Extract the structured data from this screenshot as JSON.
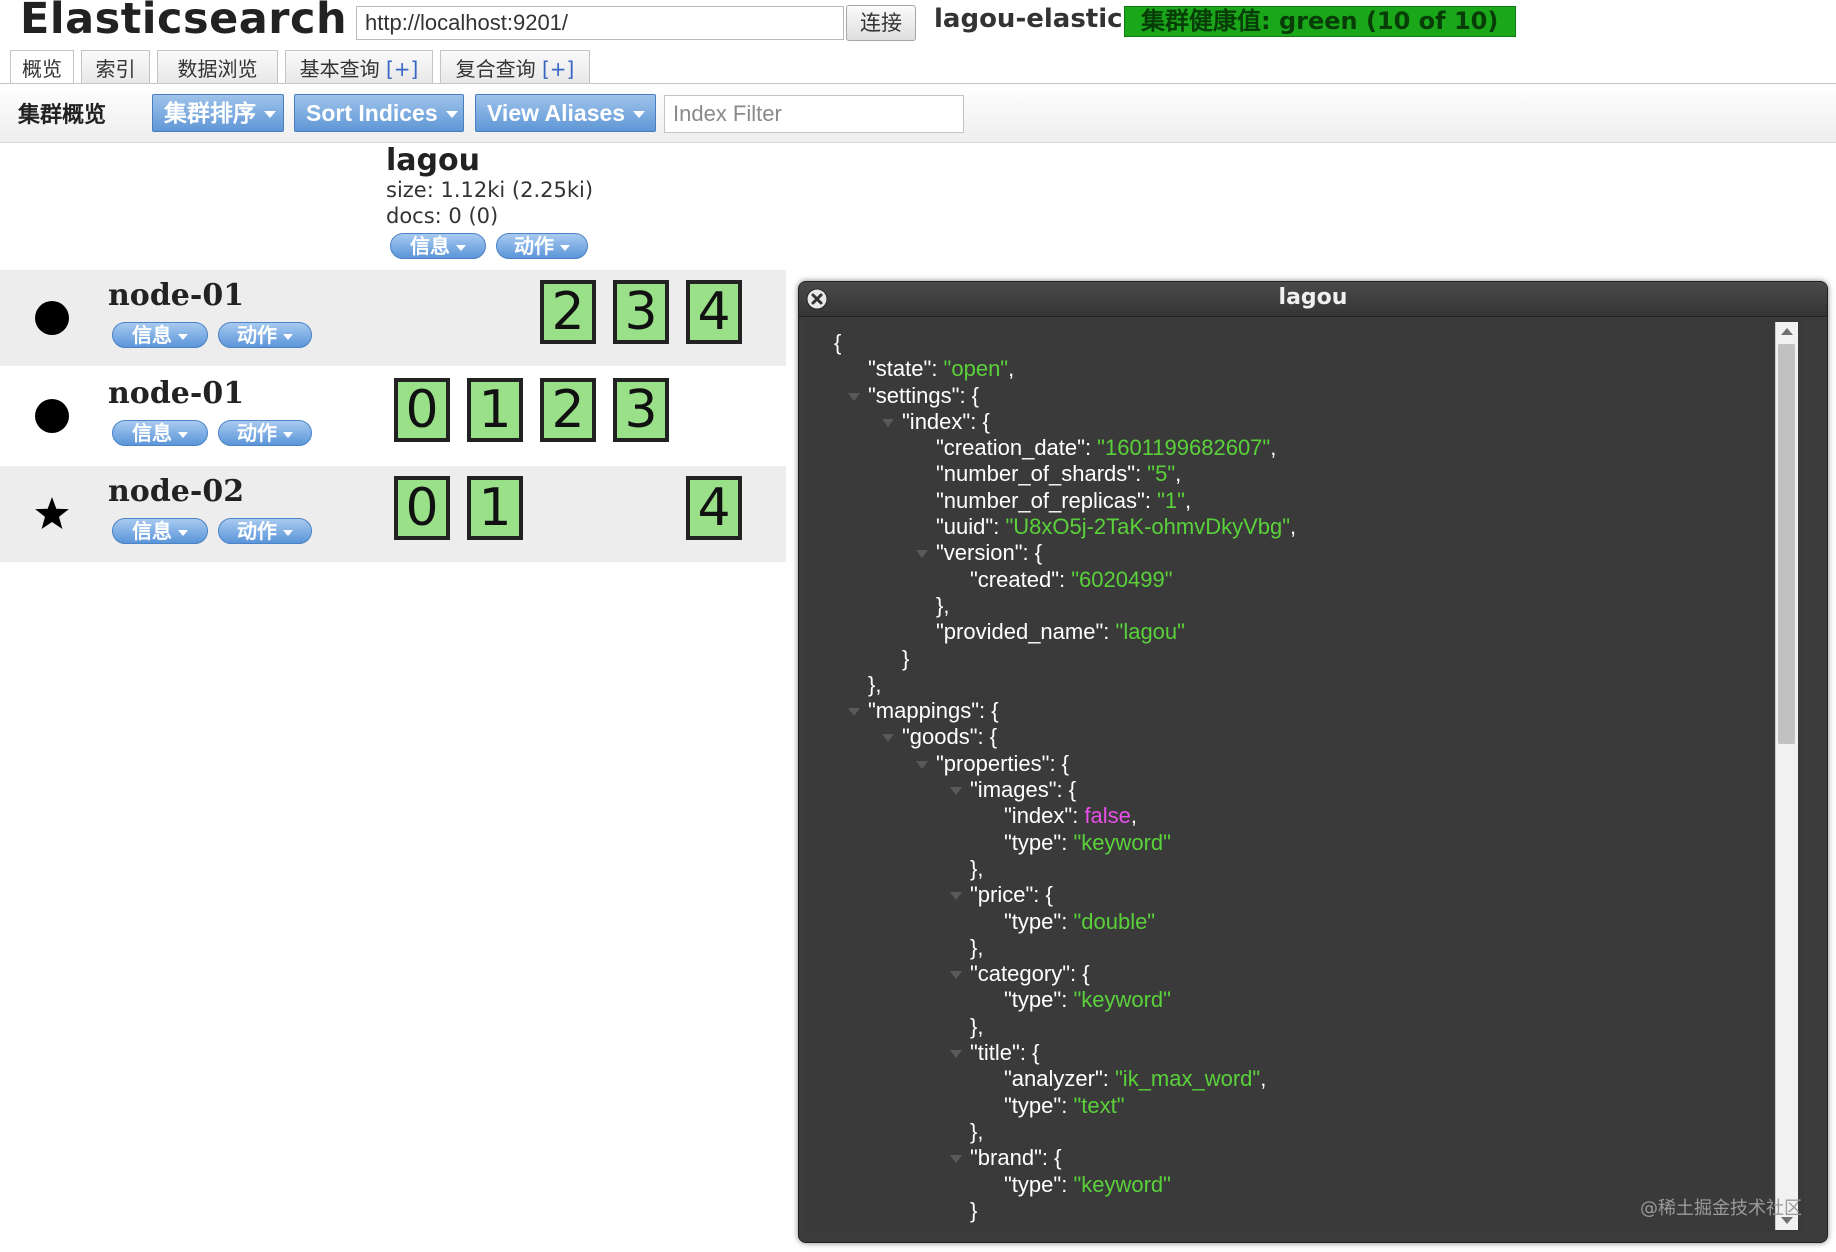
{
  "header": {
    "app_title": "Elasticsearch",
    "url_value": "http://localhost:9201/",
    "connect_label": "连接",
    "cluster_name": "lagou-elastic",
    "health_text": "集群健康值: green (10 of 10)",
    "health_color": "#1aa81a"
  },
  "tabs": [
    {
      "label": "概览",
      "plus": ""
    },
    {
      "label": "索引",
      "plus": ""
    },
    {
      "label": "数据浏览",
      "plus": ""
    },
    {
      "label": "基本查询",
      "plus": "[+]"
    },
    {
      "label": "复合查询",
      "plus": "[+]"
    }
  ],
  "toolbar": {
    "title": "集群概览",
    "sort_cluster_label": "集群排序",
    "sort_indices_label": "Sort Indices",
    "view_aliases_label": "View Aliases",
    "index_filter_placeholder": "Index Filter"
  },
  "index": {
    "name": "lagou",
    "size": "size: 1.12ki (2.25ki)",
    "docs": "docs: 0 (0)",
    "info_label": "信息",
    "action_label": "动作"
  },
  "nodes": [
    {
      "name": "node-01",
      "icon": "circle-icon",
      "info_label": "信息",
      "action_label": "动作",
      "shards": [
        "2",
        "3",
        "4"
      ]
    },
    {
      "name": "node-01",
      "icon": "circle-icon",
      "info_label": "信息",
      "action_label": "动作",
      "shards": [
        "0",
        "1",
        "2",
        "3"
      ]
    },
    {
      "name": "node-02",
      "icon": "star-icon",
      "info_label": "信息",
      "action_label": "动作",
      "shards": [
        "0",
        "1",
        "4"
      ]
    }
  ],
  "dialog": {
    "title": "lagou",
    "lines": [
      [
        "{"
      ],
      [
        "\"state\": ",
        "s:\"open\"",
        ","
      ],
      [
        "\"settings\": {"
      ],
      [
        "\"index\": {"
      ],
      [
        "\"creation_date\": ",
        "s:\"1601199682607\"",
        ","
      ],
      [
        "\"number_of_shards\": ",
        "s:\"5\"",
        ","
      ],
      [
        "\"number_of_replicas\": ",
        "s:\"1\"",
        ","
      ],
      [
        "\"uuid\": ",
        "s:\"U8xO5j-2TaK-ohmvDkyVbg\"",
        ","
      ],
      [
        "\"version\": {"
      ],
      [
        "\"created\": ",
        "s:\"6020499\""
      ],
      [
        "},"
      ],
      [
        "\"provided_name\": ",
        "s:\"lagou\""
      ],
      [
        "}"
      ],
      [
        "},"
      ],
      [
        "\"mappings\": {"
      ],
      [
        "\"goods\": {"
      ],
      [
        "\"properties\": {"
      ],
      [
        "\"images\": {"
      ],
      [
        "\"index\": ",
        "b:false",
        ","
      ],
      [
        "\"type\": ",
        "s:\"keyword\""
      ],
      [
        "},"
      ],
      [
        "\"price\": {"
      ],
      [
        "\"type\": ",
        "s:\"double\""
      ],
      [
        "},"
      ],
      [
        "\"category\": {"
      ],
      [
        "\"type\": ",
        "s:\"keyword\""
      ],
      [
        "},"
      ],
      [
        "\"title\": {"
      ],
      [
        "\"analyzer\": ",
        "s:\"ik_max_word\"",
        ","
      ],
      [
        "\"type\": ",
        "s:\"text\""
      ],
      [
        "},"
      ],
      [
        "\"brand\": {"
      ],
      [
        "\"type\": ",
        "s:\"keyword\""
      ],
      [
        "}"
      ]
    ]
  },
  "watermark": "@稀土掘金技术社区"
}
